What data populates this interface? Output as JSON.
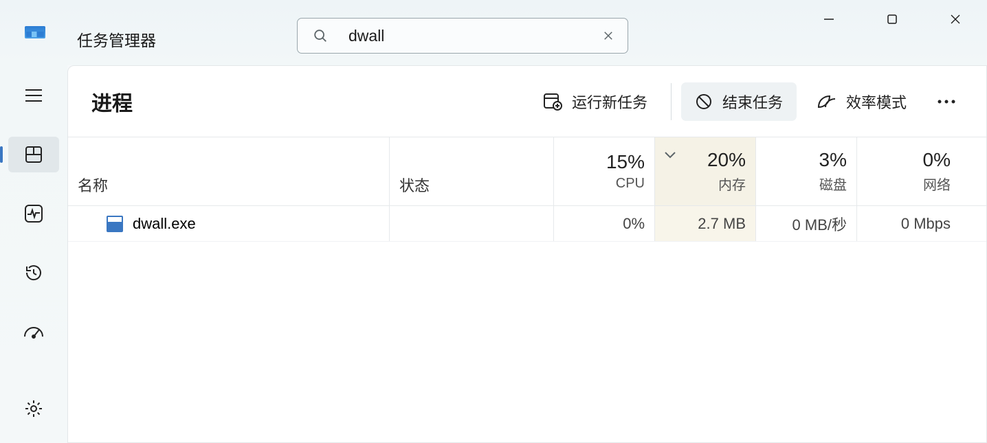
{
  "app": {
    "title": "任务管理器"
  },
  "search": {
    "value": "dwall"
  },
  "page": {
    "title": "进程",
    "actions": {
      "run_task": "运行新任务",
      "end_task": "结束任务",
      "efficiency_mode": "效率模式"
    }
  },
  "columns": {
    "name": "名称",
    "status": "状态",
    "cpu": {
      "pct": "15%",
      "label": "CPU"
    },
    "memory": {
      "pct": "20%",
      "label": "内存"
    },
    "disk": {
      "pct": "3%",
      "label": "磁盘"
    },
    "network": {
      "pct": "0%",
      "label": "网络"
    }
  },
  "rows": [
    {
      "name": "dwall.exe",
      "status": "",
      "cpu": "0%",
      "memory": "2.7 MB",
      "disk": "0 MB/秒",
      "network": "0 Mbps"
    }
  ]
}
